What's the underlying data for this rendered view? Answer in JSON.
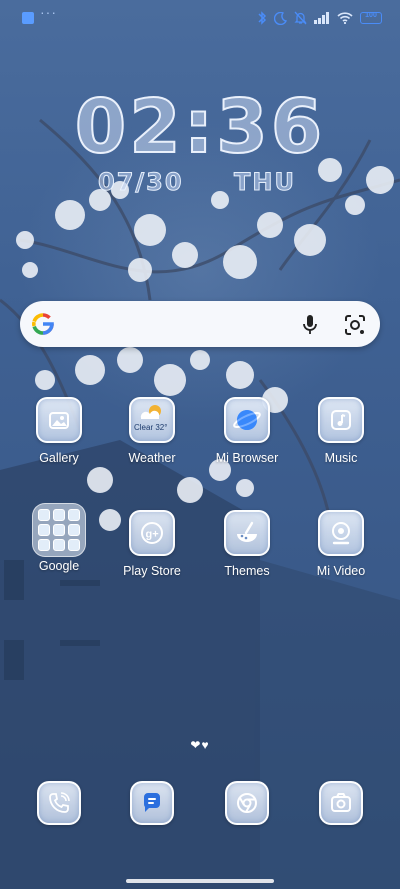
{
  "status_bar": {
    "more_indicator": "···",
    "battery_label": "100",
    "icons": [
      "app-notification-icon",
      "bluetooth-icon",
      "do-not-disturb-icon",
      "silent-icon",
      "signal-icon",
      "wifi-icon",
      "battery-icon"
    ]
  },
  "clock": {
    "time": "02:36",
    "date": "07/30",
    "weekday": "THU"
  },
  "search": {
    "icons": [
      "google-logo-icon",
      "mic-icon",
      "lens-icon"
    ]
  },
  "apps_row1": [
    {
      "label": "Gallery",
      "icon": "gallery-icon"
    },
    {
      "label": "Weather",
      "icon": "weather-icon",
      "badge": "Clear 32°"
    },
    {
      "label": "Mi Browser",
      "icon": "browser-icon"
    },
    {
      "label": "Music",
      "icon": "music-icon"
    }
  ],
  "apps_row2": [
    {
      "label": "Google",
      "icon": "folder-icon"
    },
    {
      "label": "Play Store",
      "icon": "play-store-icon"
    },
    {
      "label": "Themes",
      "icon": "themes-icon"
    },
    {
      "label": "Mi Video",
      "icon": "video-icon"
    }
  ],
  "page_indicator": "❤♥",
  "dock": [
    {
      "icon": "phone-icon"
    },
    {
      "icon": "messages-icon"
    },
    {
      "icon": "chrome-icon"
    },
    {
      "icon": "camera-icon"
    }
  ],
  "colors": {
    "accent": "#4a8cf7",
    "wallpaper": "#3f5f8f",
    "tile": "#e6eef9"
  }
}
